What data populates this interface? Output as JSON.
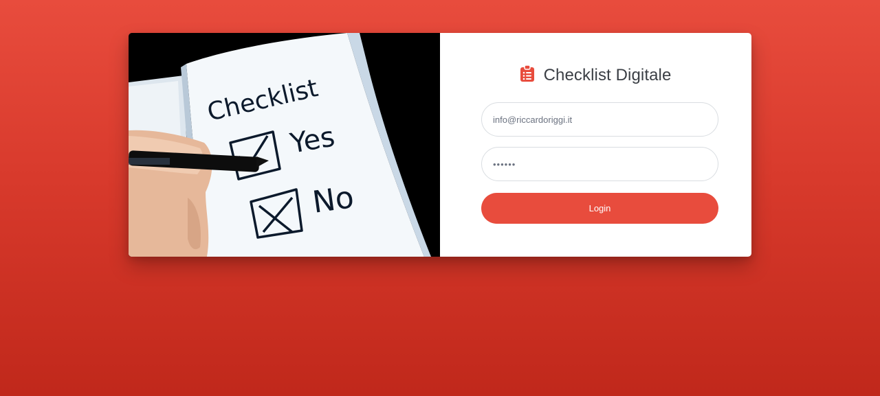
{
  "photo": {
    "notebook_heading": "Checklist",
    "option_yes": "Yes",
    "option_no": "No"
  },
  "brand": {
    "icon": "clipboard-list-icon",
    "title": "Checklist Digitale"
  },
  "form": {
    "email_value": "info@riccardoriggi.it",
    "password_value": "••••••",
    "login_label": "Login"
  },
  "colors": {
    "accent": "#e84c3d",
    "background_top": "#e84c3d",
    "background_bottom": "#c0281b"
  }
}
